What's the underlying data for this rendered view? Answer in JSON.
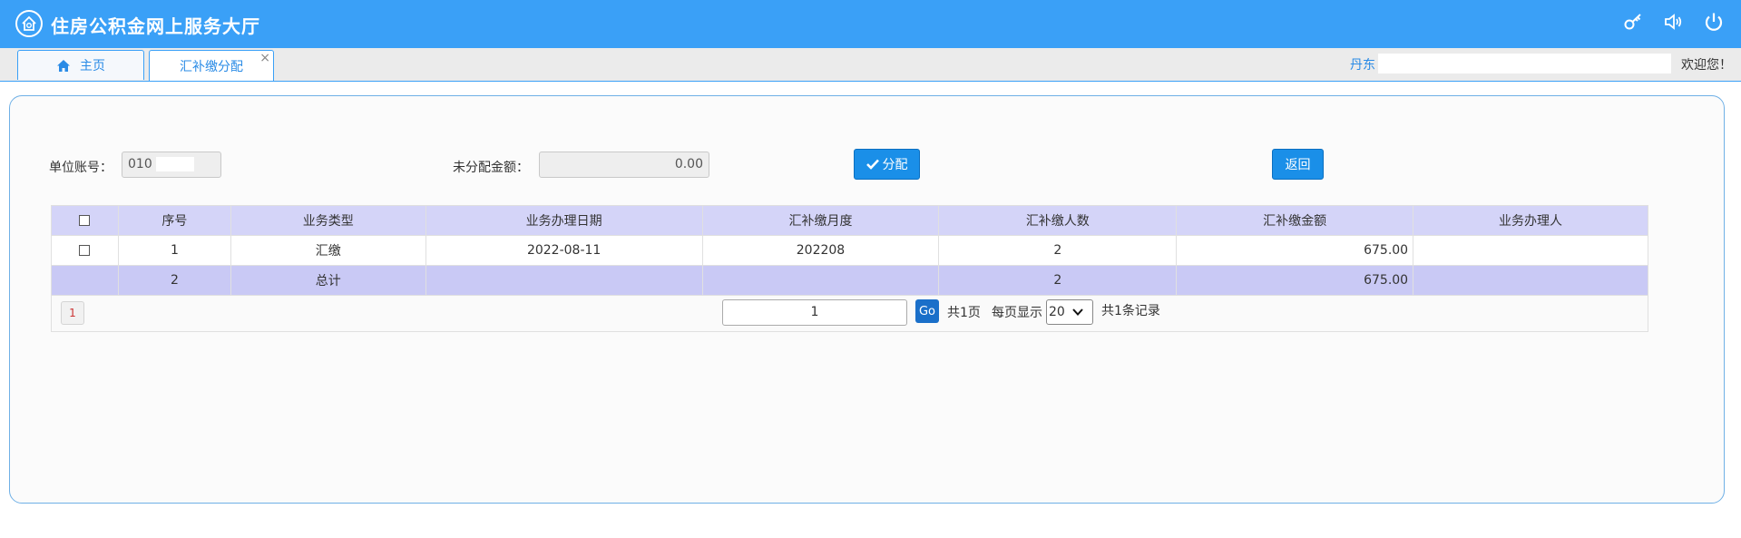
{
  "app": {
    "title": "住房公积金网上服务大厅"
  },
  "header_icons": [
    "key-icon",
    "speaker-icon",
    "power-icon"
  ],
  "tabs": [
    {
      "label": "主页",
      "icon": "home-icon"
    },
    {
      "label": "汇补缴分配",
      "close": "×"
    }
  ],
  "user": {
    "city": "丹东",
    "welcome": "欢迎您！"
  },
  "form": {
    "account_label": "单位账号：",
    "account_value": "010",
    "unallocated_label": "未分配金额：",
    "unallocated_value": "0.00",
    "allocate_button": "分配",
    "back_button": "返回"
  },
  "table": {
    "headers": [
      "序号",
      "业务类型",
      "业务办理日期",
      "汇补缴月度",
      "汇补缴人数",
      "汇补缴金额",
      "业务办理人"
    ],
    "rows": [
      {
        "index": "1",
        "type": "汇缴",
        "date": "2022-08-11",
        "month": "202208",
        "count": "2",
        "amount": "675.00",
        "handler": ""
      }
    ],
    "total": {
      "index": "2",
      "type": "总计",
      "count": "2",
      "amount": "675.00"
    }
  },
  "pager": {
    "current_page_button": "1",
    "page_input": "1",
    "go": "Go",
    "total_pages": "共1页",
    "per_page_label": "每页显示",
    "per_page_value": "20",
    "total_records": "共1条记录"
  },
  "colors": {
    "header": "#3aa0f7",
    "button": "#1a8fe8",
    "table_header": "#d4d4f8",
    "total_row": "#c9c9f5"
  }
}
